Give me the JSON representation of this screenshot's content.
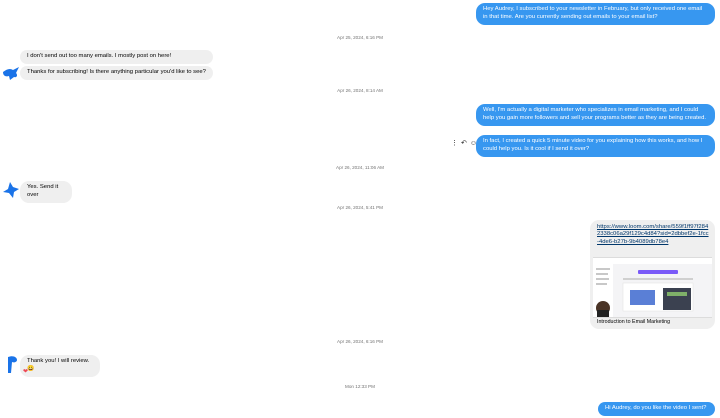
{
  "messages": {
    "m1": "Hey Audrey, I subscribed to your newsletter in February, but only received one email in that time. Are you currently sending out emails to your email list?",
    "m2": "I don't send out too many emails. I mostly post on here!",
    "m3": "Thanks for subscribing! Is there anything particular you'd like to see?",
    "m4": "Well, I'm actually a digital marketer who specializes in email marketing, and I could help you gain more followers and sell your programs better as they are being created.",
    "m5": "In fact, I created a quick 5 minute video for you explaining how this works, and how I could help you. Is it cool if I send it over?",
    "m6": "Yes. Send it over",
    "m7_link": "https://www.loom.com/share/559f1ff97f2842338c06a29f129c4d84?sid=2dbbef2e-1fcc-4de6-b27b-9b4089db78e4",
    "m7_title": "Introduction to Email Marketing",
    "m8": "Thank you! I will review. 😀",
    "m9": "Hi Audrey, do you like the video I sent?"
  },
  "timestamps": {
    "t1": "Apr 25, 2024, 6:16 PM",
    "t2": "Apr 26, 2024, 8:14 AM",
    "t3": "Apr 26, 2024, 11:06 AM",
    "t4": "Apr 26, 2024, 5:41 PM",
    "t5": "Apr 26, 2024, 6:16 PM",
    "t6": "Mon 12:33 PM"
  },
  "icons": {
    "more": "more-options-icon",
    "reply": "reply-icon",
    "emoji": "emoji-react-icon",
    "reaction": "heart-icon"
  },
  "colors": {
    "outgoing": "#3797f0",
    "incoming": "#efefef",
    "avatar_blue": "#1a73e8"
  }
}
